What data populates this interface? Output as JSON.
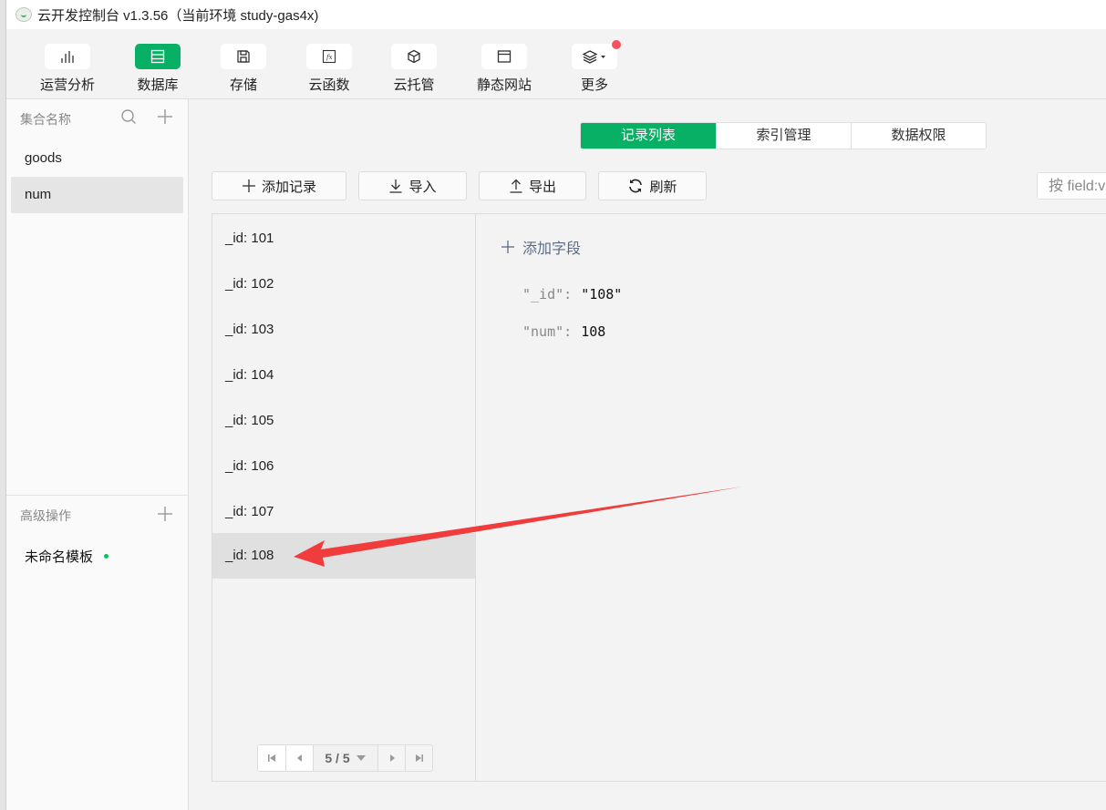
{
  "window": {
    "title": "云开发控制台 v1.3.56（当前环境 study-gas4x)"
  },
  "toolbar": {
    "items": [
      {
        "label": "运营分析",
        "icon": "bar-chart-icon"
      },
      {
        "label": "数据库",
        "icon": "database-icon",
        "active": true
      },
      {
        "label": "存储",
        "icon": "save-icon"
      },
      {
        "label": "云函数",
        "icon": "function-icon"
      },
      {
        "label": "云托管",
        "icon": "cube-icon"
      },
      {
        "label": "静态网站",
        "icon": "browser-window-icon"
      },
      {
        "label": "更多",
        "icon": "layers-icon",
        "has_badge": true
      }
    ]
  },
  "sidebar": {
    "collections_header": "集合名称",
    "collections": [
      {
        "name": "goods"
      },
      {
        "name": "num",
        "active": true
      }
    ],
    "advanced_header": "高级操作",
    "templates": [
      {
        "name": "未命名模板",
        "status_color": "#07c160"
      }
    ]
  },
  "tabs": [
    {
      "label": "记录列表",
      "active": true
    },
    {
      "label": "索引管理"
    },
    {
      "label": "数据权限"
    }
  ],
  "actions": {
    "add_record": "添加记录",
    "import": "导入",
    "export": "导出",
    "refresh": "刷新"
  },
  "search": {
    "placeholder": "按 field:value 查询"
  },
  "records": [
    {
      "label": "_id: 101"
    },
    {
      "label": "_id: 102"
    },
    {
      "label": "_id: 103"
    },
    {
      "label": "_id: 104"
    },
    {
      "label": "_id: 105"
    },
    {
      "label": "_id: 106"
    },
    {
      "label": "_id: 107"
    },
    {
      "label": "_id: 108",
      "active": true
    }
  ],
  "pagination": {
    "current": "5 / 5"
  },
  "detail": {
    "add_field_label": "添加字段",
    "fields": [
      {
        "key": "\"_id\":",
        "value": "\"108\""
      },
      {
        "key": "\"num\":",
        "value": "108"
      }
    ]
  },
  "colors": {
    "accent": "#07b064",
    "annotation_arrow": "#f03c3c",
    "badge": "#f5515f"
  }
}
